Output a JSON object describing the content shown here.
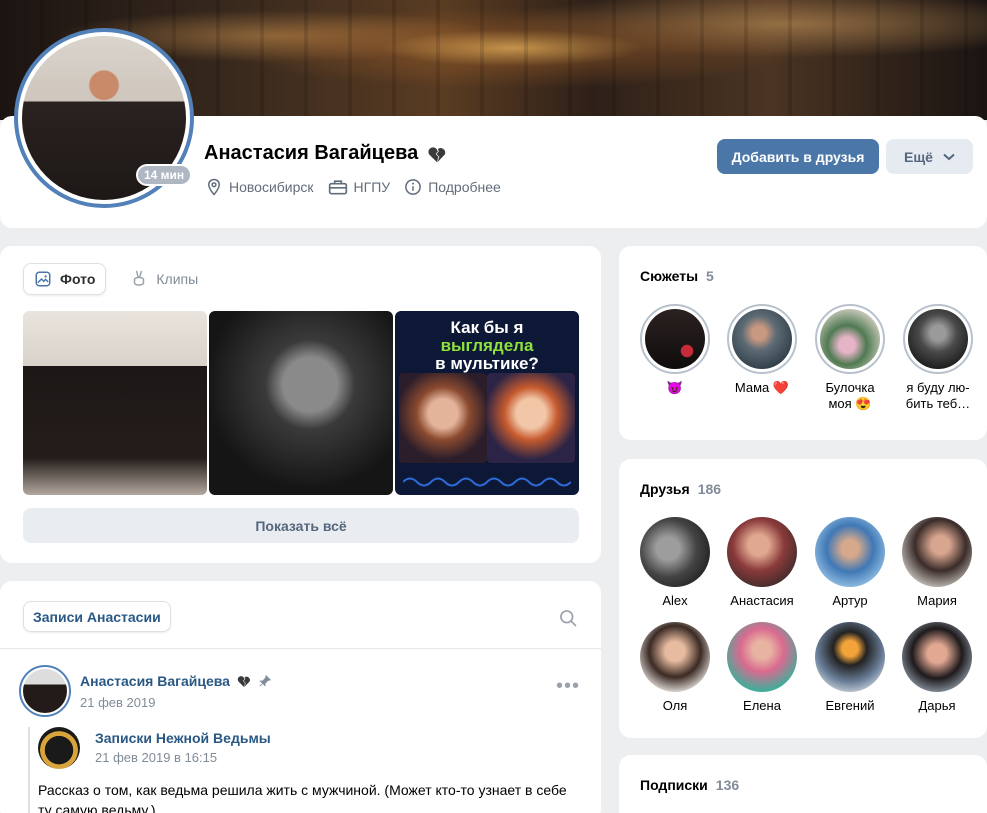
{
  "profile": {
    "name": "Анастасия Вагайцева",
    "online": "14 мин",
    "city": "Новосибирск",
    "university": "НГПУ",
    "more_info": "Подробнее",
    "add_friend": "Добавить в друзья",
    "more_button": "Ещё"
  },
  "photos": {
    "tabs": [
      {
        "label": "Фото",
        "icon": "image-icon",
        "active": true
      },
      {
        "label": "Клипы",
        "icon": "clips-icon",
        "active": false
      }
    ],
    "clip_title_line1": "Как бы я",
    "clip_title_line2": "выглядела",
    "clip_title_line3": "в мультике?",
    "show_all": "Показать всё"
  },
  "posts": {
    "tab_label": "Записи Анастасии",
    "post": {
      "author": "Анастасия Вагайцева",
      "date": "21 фев 2019",
      "repost_author": "Записки Нежной Ведьмы",
      "repost_date": "21 фев 2019 в 16:15",
      "text": "Рассказ о том, как ведьма решила жить с мужчиной. (Может кто-то узнает в себе ту самую ведьму.)"
    }
  },
  "stories": {
    "title": "Сюжеты",
    "count": "5",
    "items": [
      {
        "label": "😈"
      },
      {
        "label": "Мама ❤️"
      },
      {
        "label": "Булочка моя 😍"
      },
      {
        "label": "я буду лю-бить теб…"
      }
    ]
  },
  "friends": {
    "title": "Друзья",
    "count": "186",
    "items": [
      {
        "name": "Alex"
      },
      {
        "name": "Анастасия"
      },
      {
        "name": "Артур"
      },
      {
        "name": "Мария"
      },
      {
        "name": "Оля"
      },
      {
        "name": "Елена"
      },
      {
        "name": "Евгений"
      },
      {
        "name": "Дарья"
      }
    ]
  },
  "subscriptions": {
    "title": "Подписки",
    "count": "136"
  },
  "colors": {
    "accent": "#4a76a8",
    "link": "#2a5885",
    "background": "#edeef0"
  }
}
